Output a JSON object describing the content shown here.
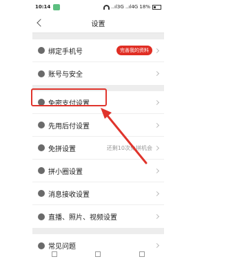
{
  "status_bar": {
    "time": "10:14",
    "carrier_text": "..ıl3G ..ıl4G 18%"
  },
  "header": {
    "title": "设置"
  },
  "sections": [
    {
      "items": [
        {
          "label": "绑定手机号",
          "badge": "完善我的资料",
          "icon": "phone-icon"
        },
        {
          "label": "账号与安全",
          "icon": "shield-icon"
        }
      ]
    },
    {
      "items": [
        {
          "label": "免密支付设置",
          "icon": "payment-icon"
        },
        {
          "label": "先用后付设置",
          "icon": "clock-pay-icon"
        },
        {
          "label": "免拼设置",
          "extra": "还剩10次免拼机会",
          "icon": "group-buy-icon"
        },
        {
          "label": "拼小圈设置",
          "icon": "circle-icon"
        },
        {
          "label": "消息接收设置",
          "icon": "message-icon"
        },
        {
          "label": "直播、照片、视频设置",
          "icon": "media-icon"
        }
      ]
    },
    {
      "items": [
        {
          "label": "常见问题",
          "icon": "help-icon"
        }
      ]
    }
  ],
  "colors": {
    "accent": "#e02e24",
    "highlight": "#e0342c",
    "background": "#ededed"
  }
}
